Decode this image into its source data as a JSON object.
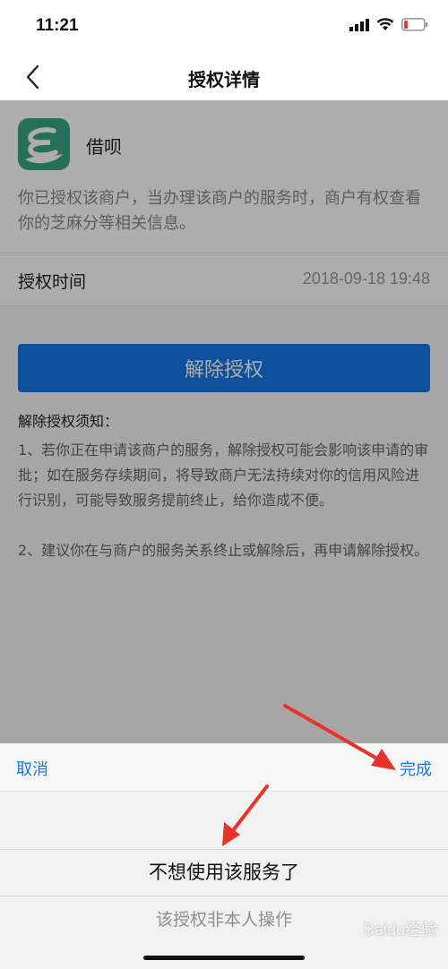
{
  "status_bar": {
    "time": "11:21"
  },
  "nav": {
    "title": "授权详情",
    "back_icon": "chevron-left-icon"
  },
  "merchant": {
    "name": "借呗",
    "description": "你已授权该商户，当办理该商户的服务时，商户有权查看你的芝麻分等相关信息。",
    "logo_color": "#36a583"
  },
  "auth_time": {
    "label": "授权时间",
    "value": "2018-09-18 19:48"
  },
  "revoke_button": {
    "label": "解除授权",
    "color": "#1478e8"
  },
  "notice": {
    "title": "解除授权须知：",
    "items": [
      "1、若你正在申请该商户的服务，解除授权可能会影响该申请的审批；如在服务存续期间，将导致商户无法持续对你的信用风险进行识别，可能导致服务提前终止，给你造成不便。",
      "2、建议你在与商户的服务关系终止或解除后，再申请解除授权。"
    ]
  },
  "picker": {
    "cancel_label": "取消",
    "done_label": "完成",
    "options": [
      "不想使用该服务了",
      "该授权非本人操作"
    ],
    "selected": "不想使用该服务了"
  },
  "watermark": "Baidu经验",
  "colors": {
    "accent": "#1478e8",
    "annotation_arrow": "#e8332a"
  }
}
